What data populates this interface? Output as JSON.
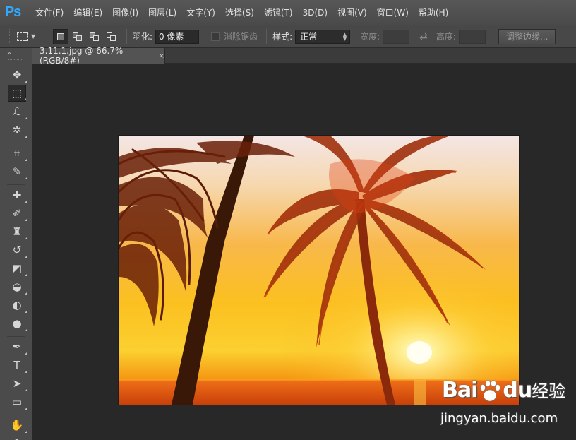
{
  "app": {
    "logo": "Ps"
  },
  "menu": [
    "文件(F)",
    "编辑(E)",
    "图像(I)",
    "图层(L)",
    "文字(Y)",
    "选择(S)",
    "滤镜(T)",
    "3D(D)",
    "视图(V)",
    "窗口(W)",
    "帮助(H)"
  ],
  "options": {
    "feather_label": "羽化:",
    "feather_value": "0 像素",
    "antialias_label": "消除锯齿",
    "style_label": "样式:",
    "style_value": "正常",
    "width_label": "宽度:",
    "height_label": "高度:",
    "refine_edge": "调整边缘..."
  },
  "document": {
    "tab_title": "3.11.1.jpg @ 66.7%(RGB/8#)",
    "close_glyph": "×"
  },
  "toolbar": {
    "header_glyph": "»",
    "tools": [
      {
        "name": "move-tool",
        "glyph": "✥"
      },
      {
        "name": "rectangular-marquee-tool",
        "glyph": "⬚"
      },
      {
        "name": "lasso-tool",
        "glyph": "ℒ"
      },
      {
        "name": "magic-wand-tool",
        "glyph": "✲"
      },
      {
        "name": "crop-tool",
        "glyph": "⌗"
      },
      {
        "name": "eyedropper-tool",
        "glyph": "✎"
      },
      {
        "name": "healing-brush-tool",
        "glyph": "✚"
      },
      {
        "name": "brush-tool",
        "glyph": "✐"
      },
      {
        "name": "clone-stamp-tool",
        "glyph": "♜"
      },
      {
        "name": "history-brush-tool",
        "glyph": "↺"
      },
      {
        "name": "eraser-tool",
        "glyph": "◩"
      },
      {
        "name": "paint-bucket-tool",
        "glyph": "◒"
      },
      {
        "name": "blur-tool",
        "glyph": "◐"
      },
      {
        "name": "dodge-tool",
        "glyph": "●"
      },
      {
        "name": "pen-tool",
        "glyph": "✒"
      },
      {
        "name": "type-tool",
        "glyph": "T"
      },
      {
        "name": "path-selection-tool",
        "glyph": "➤"
      },
      {
        "name": "rectangle-tool",
        "glyph": "▭"
      },
      {
        "name": "hand-tool",
        "glyph": "✋"
      },
      {
        "name": "zoom-tool",
        "glyph": "⚲"
      }
    ]
  },
  "watermark": {
    "brand": "Bai",
    "brand_tail": "du",
    "product": "经验",
    "url": "jingyan.baidu.com"
  },
  "colors": {
    "ps_blue": "#31a8ff",
    "sky_top": "#f6e8e8",
    "sun": "#fff7c8",
    "sea": "#e05a10"
  }
}
